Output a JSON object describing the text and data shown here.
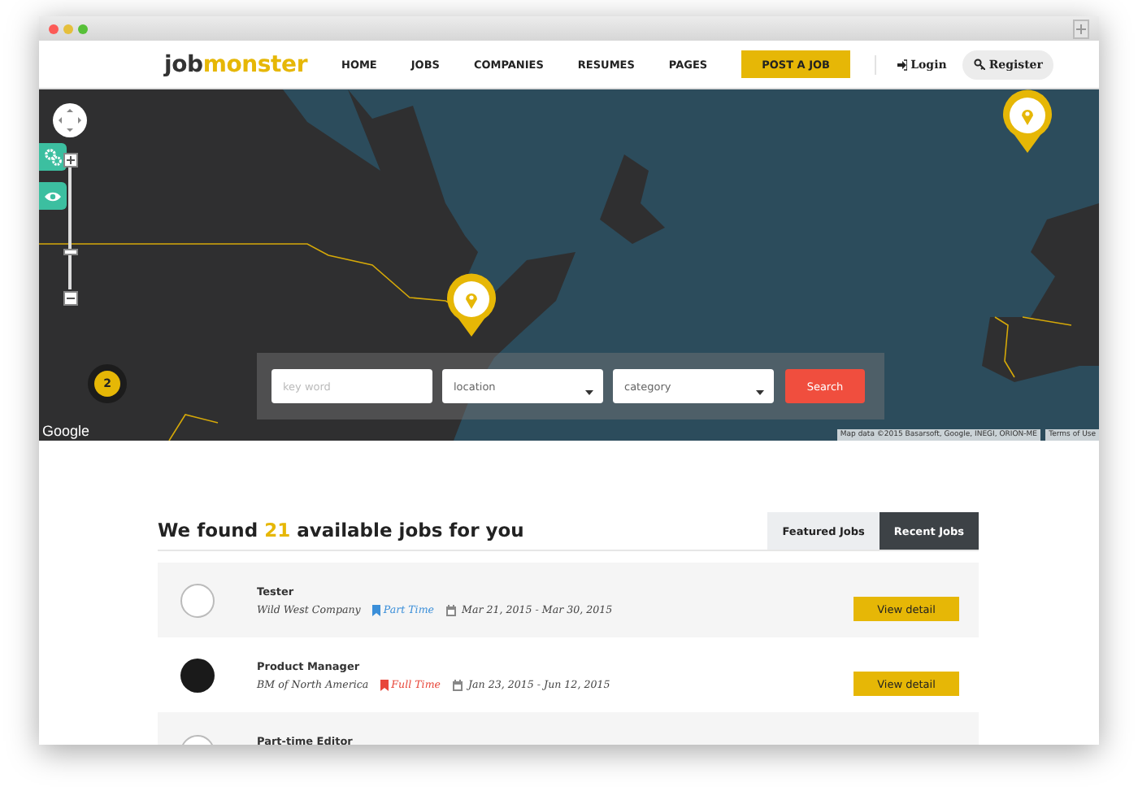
{
  "nav": {
    "logo": {
      "text": "job",
      "accent": "monster"
    },
    "items": [
      {
        "label": "HOME"
      },
      {
        "label": "JOBS"
      },
      {
        "label": "COMPANIES"
      },
      {
        "label": "RESUMES"
      },
      {
        "label": "PAGES"
      }
    ],
    "post_button": "POST A JOB",
    "login": "Login",
    "register": "Register"
  },
  "map": {
    "zoom": {
      "level": 0.3
    },
    "cluster": "2",
    "search": {
      "keyword_placeholder": "key word",
      "location": "location",
      "category": "category",
      "button": "Search"
    },
    "logo": "Google",
    "attribution": "Map data ©2015 Basarsoft, Google, INEGI, ORION-ME",
    "terms": "Terms of Use"
  },
  "results": {
    "heading": {
      "before": "We found ",
      "count": "21",
      "after": " available jobs for you"
    },
    "tabs": [
      {
        "label": "Featured Jobs",
        "selected": false
      },
      {
        "label": "Recent Jobs",
        "selected": true
      }
    ],
    "jobs": [
      {
        "title": "Tester",
        "company": "Wild West Company",
        "type": "Part Time",
        "color": "#3b8fd9",
        "dates": "Mar 21, 2015 - Mar 30, 2015",
        "button": "View detail",
        "kind": "light"
      },
      {
        "title": "Product Manager",
        "company": "BM of North America",
        "type": "Full Time",
        "color": "#e8473a",
        "dates": "Jan 23, 2015 - Jun 12, 2015",
        "button": "View detail",
        "kind": "dark"
      },
      {
        "title": "Part-time Editor",
        "kind": "light"
      }
    ]
  }
}
